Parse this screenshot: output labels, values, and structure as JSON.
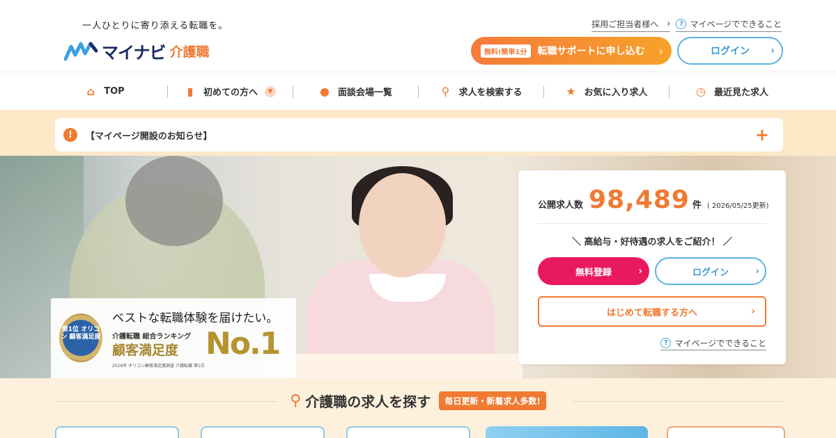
{
  "header": {
    "tagline": "一人ひとりに寄り添える転職を。",
    "logo_text": "マイナビ",
    "logo_sub": "介護職",
    "recruiter_link": "採用ご担当者様へ",
    "mypage_help_link": "マイページでできること",
    "support_pill": "無料!簡単1分",
    "support_button": "転職サポートに申し込む",
    "login_button": "ログイン",
    "colors": {
      "accent": "#f07a32",
      "brand_navy": "#1a2a63",
      "login_blue": "#59b2e0"
    }
  },
  "nav": {
    "items": [
      {
        "label": "TOP",
        "icon": "home-icon"
      },
      {
        "label": "初めての方へ",
        "icon": "beginner-icon"
      },
      {
        "label": "面談会場一覧",
        "icon": "map-pin-icon"
      },
      {
        "label": "求人を検索する",
        "icon": "search-icon"
      },
      {
        "label": "お気に入り求人",
        "icon": "star-icon"
      },
      {
        "label": "最近見た求人",
        "icon": "clock-icon"
      }
    ]
  },
  "notice": {
    "text": "【マイページ開設のお知らせ】"
  },
  "award": {
    "line1": "ベストな転職体験を届けたい。",
    "line2": "介護転職 総合ランキング",
    "line3": "顧客満足度",
    "no1": "No.1",
    "medal_text": "第1位 オリコン 顧客満足度",
    "footnote": "2026年 オリコン顧客満足度調査 介護転職 第1位"
  },
  "panel": {
    "jobs_label": "公開求人数",
    "jobs_count": "98,489",
    "jobs_unit": "件",
    "updated": "( 2026/05/25更新)",
    "catch": "＼ 高給与・好待遇の求人をご紹介！ ／",
    "register_button": "無料登録",
    "login_button": "ログイン",
    "first_button": "はじめて転職する方へ",
    "help_link": "マイページでできること",
    "colors": {
      "register": "#e8195e"
    }
  },
  "search": {
    "title": "介護職の求人を探す",
    "badge": "毎日更新・新着求人多数!"
  }
}
